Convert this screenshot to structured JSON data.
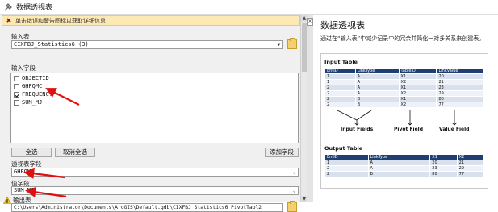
{
  "window": {
    "title": "数据透视表"
  },
  "banner": {
    "text": "单击错误和警告图标以获取详细信息"
  },
  "input_table": {
    "label": "输入表",
    "value": "CIXFBJ_Statistics6 (3)"
  },
  "input_fields": {
    "label": "输入字段",
    "items": [
      {
        "name": "OBJECTID",
        "checked": false
      },
      {
        "name": "GHFQMC",
        "checked": false
      },
      {
        "name": "FREQUENCY",
        "checked": true
      },
      {
        "name": "SUM_MJ",
        "checked": false
      }
    ]
  },
  "buttons": {
    "select_all": "全选",
    "clear_all": "取消全选",
    "add_field": "添加字段"
  },
  "pivot_field": {
    "label": "透视表字段",
    "value": "GHFQMC"
  },
  "value_field": {
    "label": "值字段",
    "value": "SUM_MJ"
  },
  "output_table": {
    "label": "输出表",
    "value": "C:\\Users\\Administrator\\Documents\\ArcGIS\\Default.gdb\\CIXFBJ_Statistics6_PivotTabl2"
  },
  "help": {
    "title": "数据透视表",
    "description": "通过在“输入表”中减少记录中的冗余并简化一对多关系来创建表。",
    "diagram": {
      "input_heading": "Input Table",
      "input_columns": [
        "EntID",
        "LinkType",
        "TableID",
        "LinkValue"
      ],
      "input_rows": [
        [
          "1",
          "A",
          "X1",
          "20"
        ],
        [
          "1",
          "A",
          "X2",
          "21"
        ],
        [
          "2",
          "A",
          "X1",
          "23"
        ],
        [
          "2",
          "A",
          "X2",
          "29"
        ],
        [
          "2",
          "B",
          "X1",
          "80"
        ],
        [
          "2",
          "B",
          "X2",
          "77"
        ]
      ],
      "callouts": {
        "input_fields": "Input Fields",
        "pivot_field": "Pivot Field",
        "value_field": "Value Field"
      },
      "output_heading": "Output Table",
      "output_columns": [
        "EntID",
        "LinkType",
        "X1",
        "X2"
      ],
      "output_rows": [
        [
          "1",
          "A",
          "20",
          "21"
        ],
        [
          "2",
          "A",
          "23",
          "29"
        ],
        [
          "2",
          "B",
          "80",
          "77"
        ]
      ]
    }
  },
  "colors": {
    "table_header": "#1f3f73",
    "annotation_arrow": "#e01010"
  }
}
